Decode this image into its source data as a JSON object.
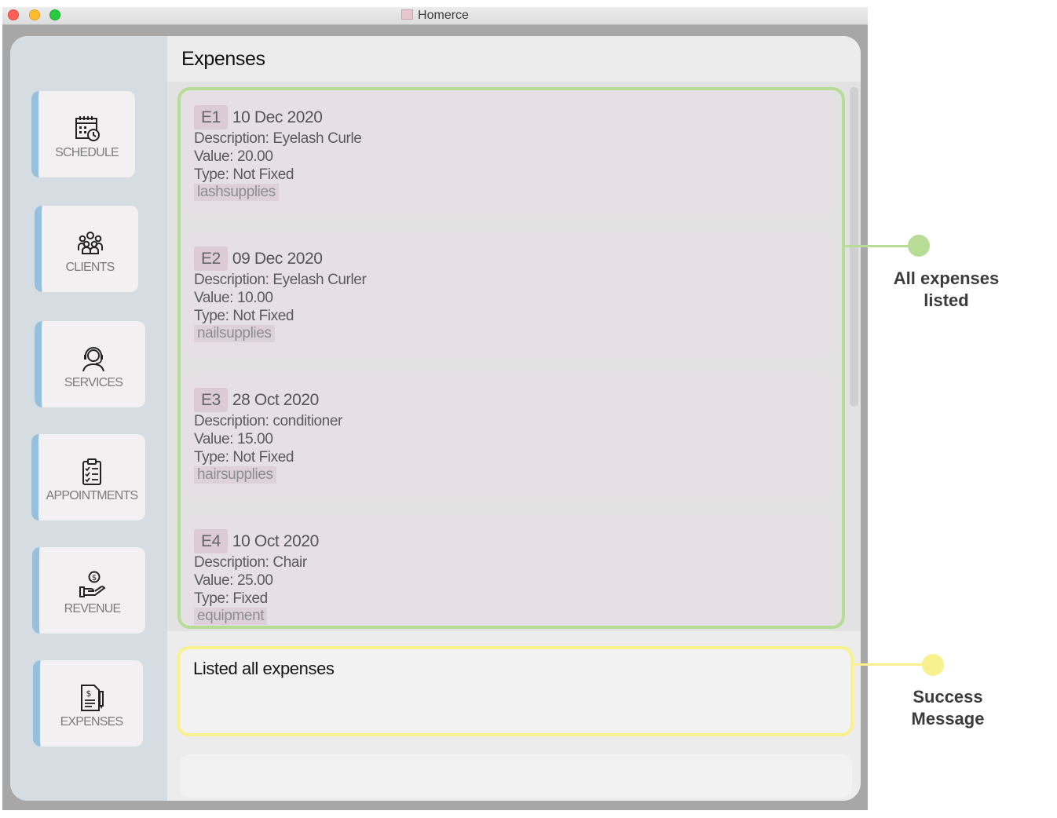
{
  "window": {
    "title": "Homerce"
  },
  "header": {
    "title": "Expenses"
  },
  "sidebar": {
    "items": [
      {
        "label": "SCHEDULE",
        "icon": "calendar-clock-icon"
      },
      {
        "label": "CLIENTS",
        "icon": "people-group-icon"
      },
      {
        "label": "SERVICES",
        "icon": "headset-agent-icon"
      },
      {
        "label": "APPOINTMENTS",
        "icon": "clipboard-checklist-icon"
      },
      {
        "label": "REVENUE",
        "icon": "hand-coin-icon"
      },
      {
        "label": "EXPENSES",
        "icon": "document-dollar-icon"
      }
    ],
    "accent_color": "#97bfde"
  },
  "expenses": [
    {
      "id": "E1",
      "date": "10 Dec 2020",
      "description": "Description: Eyelash Curle",
      "value": "Value: 20.00",
      "type": "Type: Not Fixed",
      "tag": "lashsupplies"
    },
    {
      "id": "E2",
      "date": "09 Dec 2020",
      "description": "Description: Eyelash Curler",
      "value": "Value: 10.00",
      "type": "Type: Not Fixed",
      "tag": "nailsupplies"
    },
    {
      "id": "E3",
      "date": "28 Oct 2020",
      "description": "Description: conditioner",
      "value": "Value: 15.00",
      "type": "Type: Not Fixed",
      "tag": "hairsupplies"
    },
    {
      "id": "E4",
      "date": "10 Oct 2020",
      "description": "Description: Chair",
      "value": "Value: 25.00",
      "type": "Type: Fixed",
      "tag": "equipment"
    }
  ],
  "result": {
    "message": "Listed all expenses"
  },
  "command": {
    "value": ""
  },
  "annotations": [
    {
      "label_line1": "All expenses",
      "label_line2": "listed",
      "color": "#b7dc96"
    },
    {
      "label_line1": "Success",
      "label_line2": "Message",
      "color": "#f8f18d"
    }
  ]
}
